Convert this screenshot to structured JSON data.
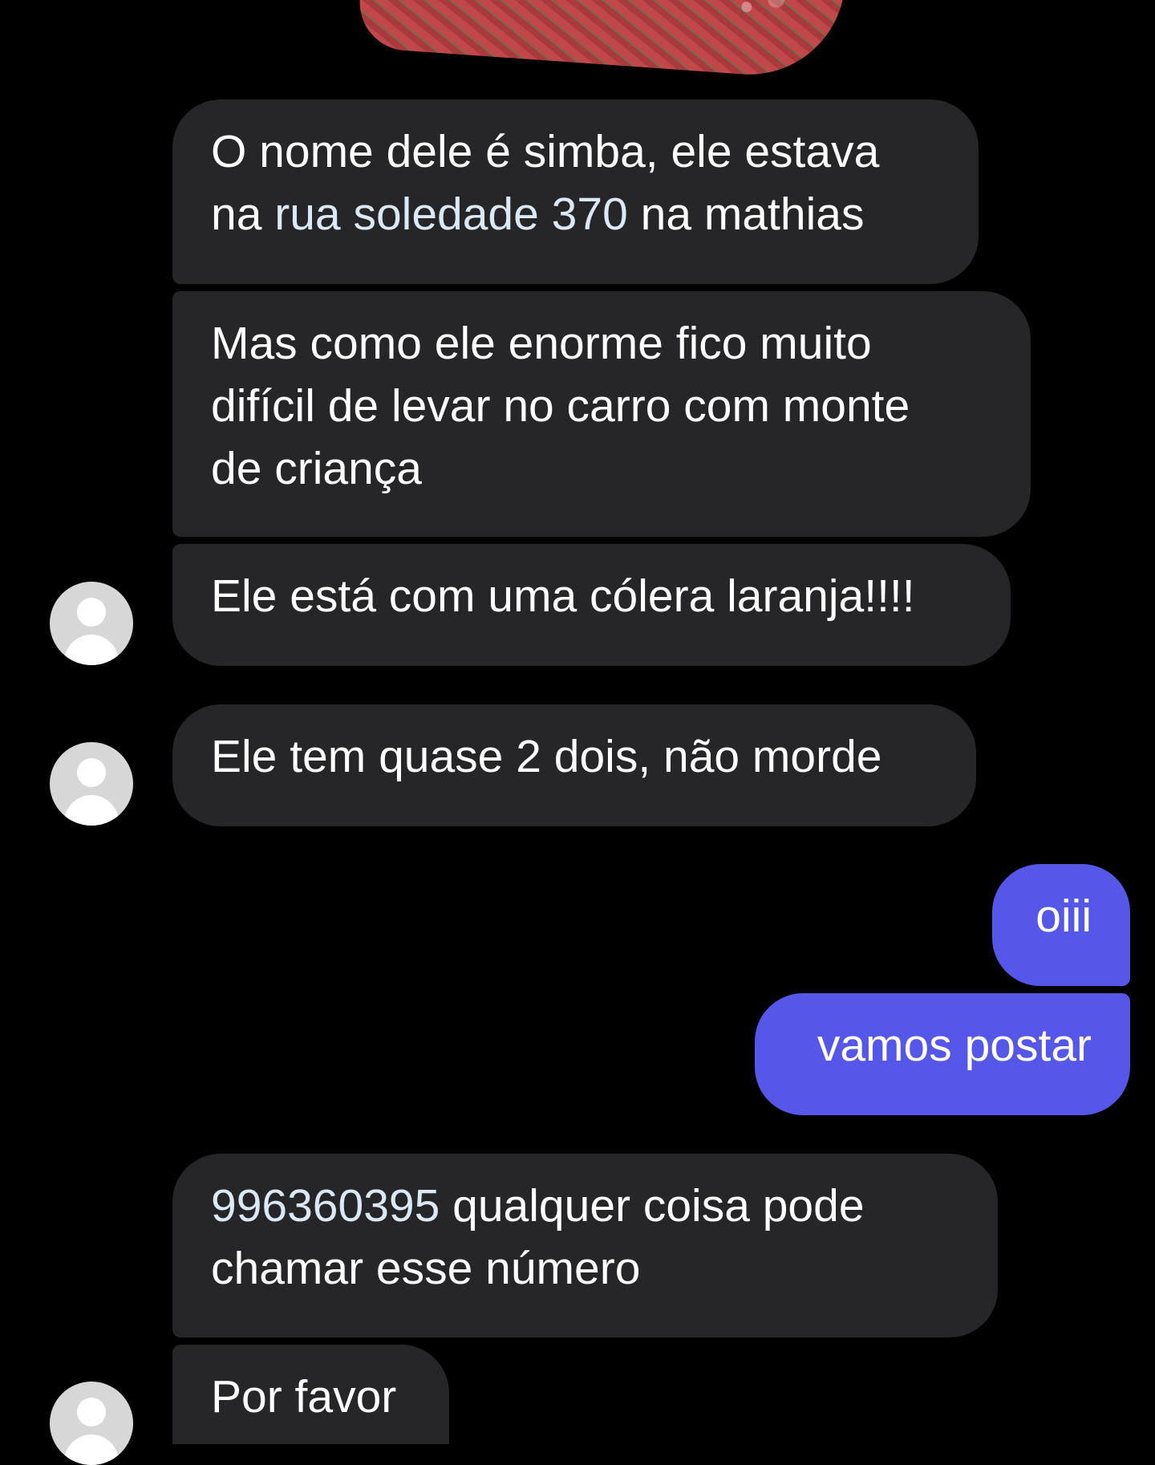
{
  "messages": [
    {
      "id": "m1",
      "direction": "incoming",
      "parts": [
        "O nome dele é simba, ele estava\nna ",
        "rua soledade 370",
        " na mathias"
      ]
    },
    {
      "id": "m2",
      "direction": "incoming",
      "text": "Mas como ele enorme fico muito\ndifícil de levar no carro com monte\nde criança"
    },
    {
      "id": "m3",
      "direction": "incoming",
      "text": "Ele está com uma cólera laranja!!!!"
    },
    {
      "id": "m4",
      "direction": "incoming",
      "text": "Ele tem quase 2 dois, não morde"
    },
    {
      "id": "m5",
      "direction": "outgoing",
      "text": "oiii"
    },
    {
      "id": "m6",
      "direction": "outgoing",
      "text": "vamos postar"
    },
    {
      "id": "m7",
      "direction": "incoming",
      "parts": [
        "996360395",
        " qualquer coisa pode\nchamar esse número"
      ]
    },
    {
      "id": "m8",
      "direction": "incoming",
      "text": "Por favor"
    }
  ],
  "colors": {
    "background": "#000000",
    "incoming_bubble": "#262628",
    "outgoing_bubble": "#5557e8",
    "link_text": "#dbe8f6",
    "avatar": "#d7d7d7"
  },
  "icons": {
    "avatar": "default-profile-avatar-icon"
  }
}
